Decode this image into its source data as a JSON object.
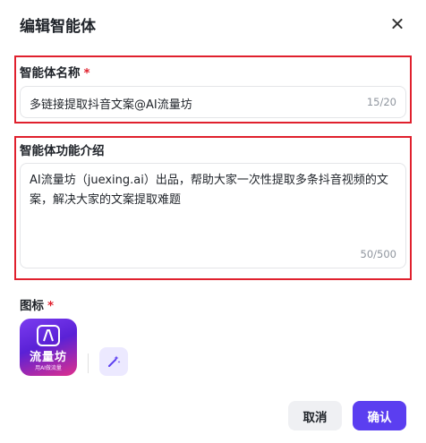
{
  "dialog": {
    "title": "编辑智能体"
  },
  "name_field": {
    "label": "智能体名称",
    "required_mark": "*",
    "value": "多链接提取抖音文案@AI流量坊",
    "counter": "15/20"
  },
  "description_field": {
    "label": "智能体功能介绍",
    "value": "AI流量坊（juexing.ai）出品，帮助大家一次性提取多条抖音视频的文案，解决大家的文案提取难题",
    "counter": "50/500"
  },
  "icon_field": {
    "label": "图标",
    "required_mark": "*",
    "avatar_title": "流量坊",
    "avatar_subtitle": "用AI做流量"
  },
  "footer": {
    "cancel_label": "取消",
    "confirm_label": "确认"
  },
  "colors": {
    "primary": "#5b3ef0",
    "required": "#e0202d",
    "highlight_border": "#e0202d"
  },
  "icons": [
    "close-icon",
    "magic-wand-icon",
    "app-logo-icon"
  ]
}
